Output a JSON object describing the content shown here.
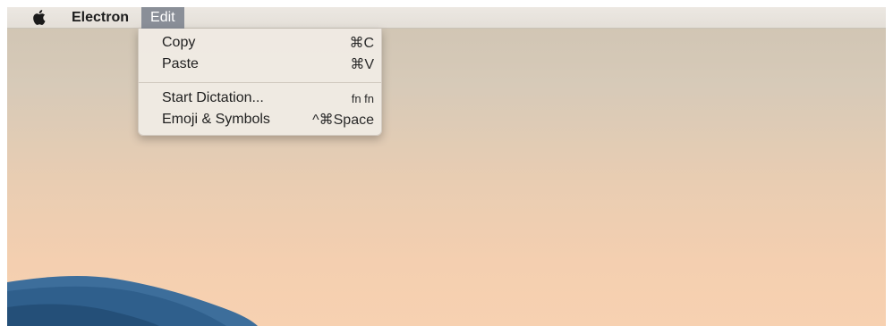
{
  "menubar": {
    "app_name": "Electron",
    "active_menu": "Edit"
  },
  "edit_menu": {
    "items": [
      {
        "label": "Copy",
        "shortcut": "⌘C"
      },
      {
        "label": "Paste",
        "shortcut": "⌘V"
      },
      {
        "label": "Start Dictation...",
        "shortcut": "fn fn"
      },
      {
        "label": "Emoji & Symbols",
        "shortcut": "^⌘Space"
      }
    ]
  },
  "icons": {
    "apple": "apple-logo-icon"
  },
  "colors": {
    "menu_highlight": "#8a8f98",
    "menubar_bg": "#e8e4de",
    "desktop_top": "#cfc4b3",
    "desktop_bottom": "#f7d1b1"
  }
}
